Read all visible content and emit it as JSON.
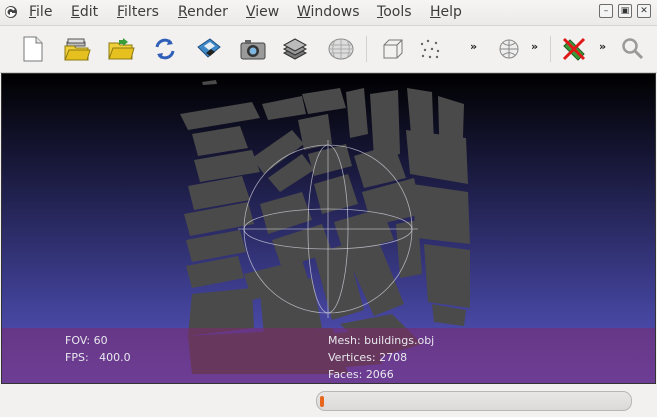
{
  "menubar": {
    "items": [
      {
        "label": "File",
        "mnemonic": "F",
        "rest": "ile"
      },
      {
        "label": "Edit",
        "mnemonic": "E",
        "rest": "dit"
      },
      {
        "label": "Filters",
        "mnemonic": "F",
        "rest": "ilters"
      },
      {
        "label": "Render",
        "mnemonic": "R",
        "rest": "ender"
      },
      {
        "label": "View",
        "mnemonic": "V",
        "rest": "iew"
      },
      {
        "label": "Windows",
        "mnemonic": "W",
        "rest": "indows"
      },
      {
        "label": "Tools",
        "mnemonic": "T",
        "rest": "ools"
      },
      {
        "label": "Help",
        "mnemonic": "H",
        "rest": "elp"
      }
    ],
    "window_controls": {
      "minimize": "–",
      "restore": "▣",
      "close": "✕"
    }
  },
  "toolbar": {
    "overflow_glyph": "»",
    "icons": [
      "new-project-icon",
      "import-mesh-icon",
      "open-project-icon",
      "reload-icon",
      "save-icon",
      "snapshot-icon",
      "layers-icon",
      "render-mode-icon",
      "bounding-box-icon",
      "points-icon",
      "sphere-icon",
      "delete-icon",
      "search-icon"
    ]
  },
  "viewport": {
    "fov": {
      "label": "FOV:",
      "value": "60"
    },
    "fps": {
      "label": "FPS:",
      "value": "400.0"
    },
    "mesh": {
      "label": "Mesh:",
      "value": "buildings.obj"
    },
    "vertices": {
      "label": "Vertices:",
      "value": "2708"
    },
    "faces": {
      "label": "Faces:",
      "value": "2066"
    },
    "colors": {
      "top": "#000000",
      "bottom": "#5959c6",
      "mesh": "#4a4a4a",
      "overlay": "#80286e"
    }
  },
  "status": {
    "progress_fraction": 0.01
  }
}
